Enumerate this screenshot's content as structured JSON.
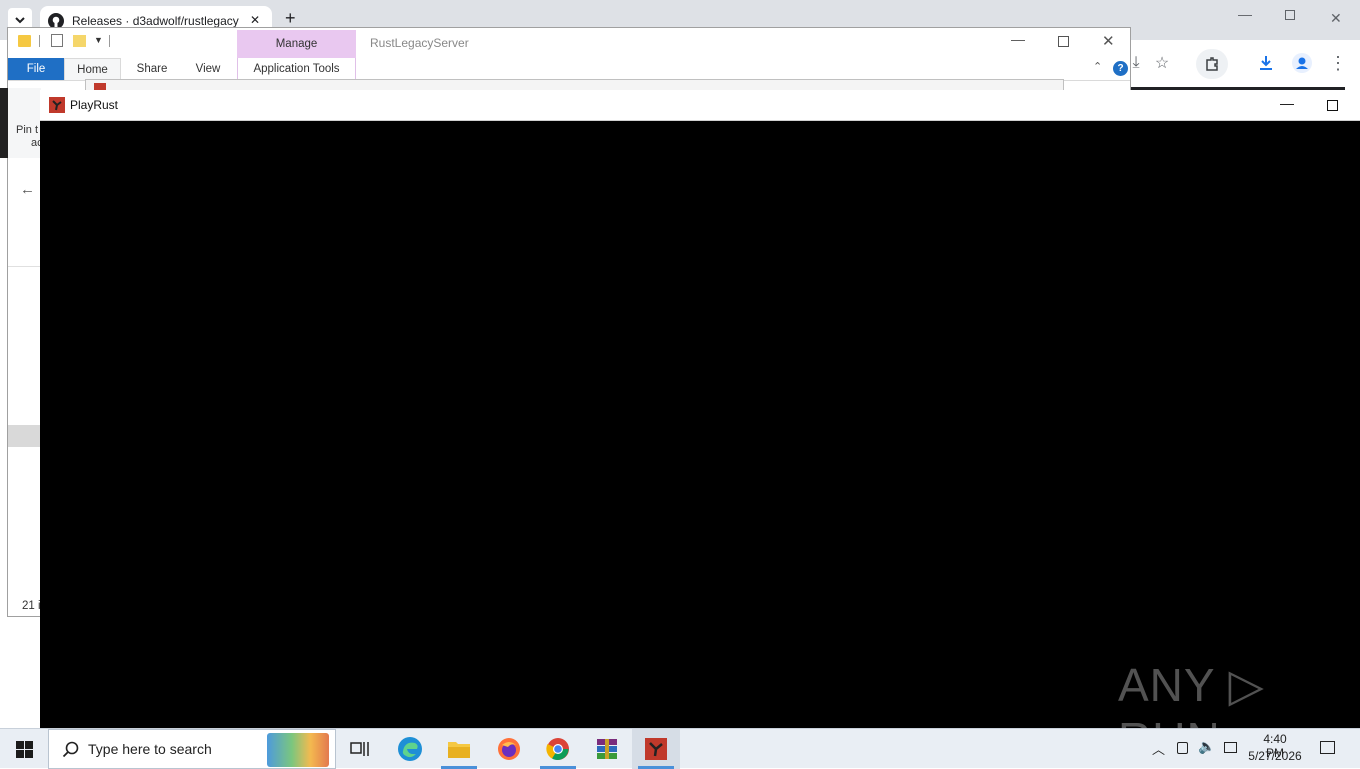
{
  "chrome": {
    "tab_title": "Releases · d3adwolf/rustlegacy",
    "new_tab_symbol": "+",
    "close_symbol": "✕"
  },
  "explorer": {
    "window_title": "RustLegacyServer",
    "manage_label": "Manage",
    "ribbon_tabs": [
      "File",
      "Home",
      "Share",
      "View",
      "Application Tools"
    ],
    "pin_text_1": "Pin t",
    "pin_text_2": "ac",
    "status_items": "21 i"
  },
  "playrust": {
    "window_title": "PlayRust"
  },
  "taskbar": {
    "search_placeholder": "Type here to search",
    "time": "4:40 PM",
    "date": "5/27/2026"
  },
  "watermark": {
    "text": "ANY ▷ RUN"
  },
  "colors": {
    "file_tab": "#1f6fc5",
    "manage_tab": "#e9c8f0",
    "game_bg": "#000000",
    "taskbar_bg": "#e9eef4"
  }
}
